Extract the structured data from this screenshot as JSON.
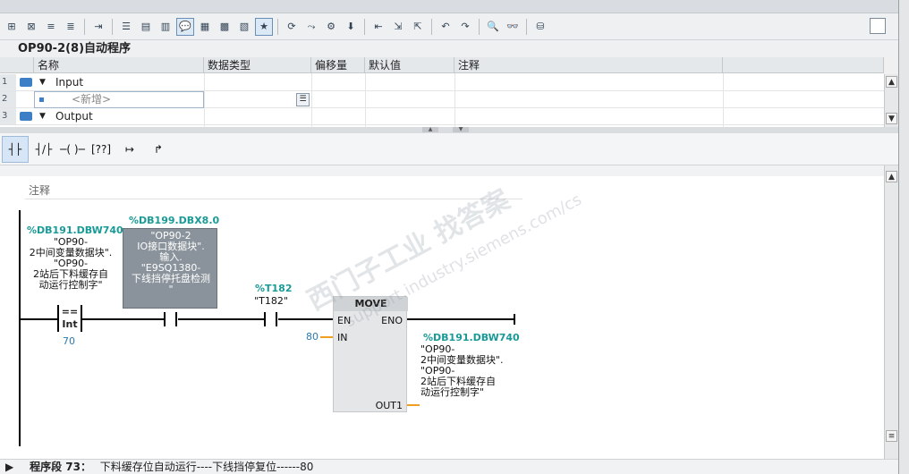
{
  "block_title": "OP90-2(8)自动程序",
  "interface": {
    "headers": [
      "名称",
      "数据类型",
      "偏移量",
      "默认值",
      "注释"
    ],
    "rows": [
      {
        "num": "1",
        "name": "Input"
      },
      {
        "num": "2",
        "placeholder": "<新增>"
      },
      {
        "num": "3",
        "name": "Output"
      }
    ]
  },
  "network": {
    "comment_label": "注释",
    "cmp": {
      "address": "%DB191.DBW740",
      "symbol_lines": [
        "\"OP90-",
        "2中间变量数据块\".",
        "\"OP90-",
        "2站后下料缓存自",
        "动运行控制字\""
      ],
      "op": "==",
      "type": "Int",
      "value": "70"
    },
    "contact1": {
      "address": "%DB199.DBX8.0",
      "symbol_lines": [
        "\"OP90-2",
        "IO接口数据块\".",
        "输入.",
        "\"E9SQ1380-",
        "下线挡停托盘检测",
        "\""
      ]
    },
    "contact2": {
      "address": "%T182",
      "symbol": "\"T182\""
    },
    "move": {
      "title": "MOVE",
      "en": "EN",
      "eno": "ENO",
      "in_label": "IN",
      "in_value": "80",
      "out_label": "OUT1",
      "out_address": "%DB191.DBW740",
      "out_symbol_lines": [
        "\"OP90-",
        "2中间变量数据块\".",
        "\"OP90-",
        "2站后下料缓存自",
        "动运行控制字\""
      ]
    }
  },
  "bottom_network": {
    "label": "程序段 73：",
    "title": "下料缓存位自动运行----下线挡停复位------80"
  },
  "watermark": {
    "main": "西门子工业 找答案",
    "sub": "support.industry.siemens.com/cs"
  }
}
